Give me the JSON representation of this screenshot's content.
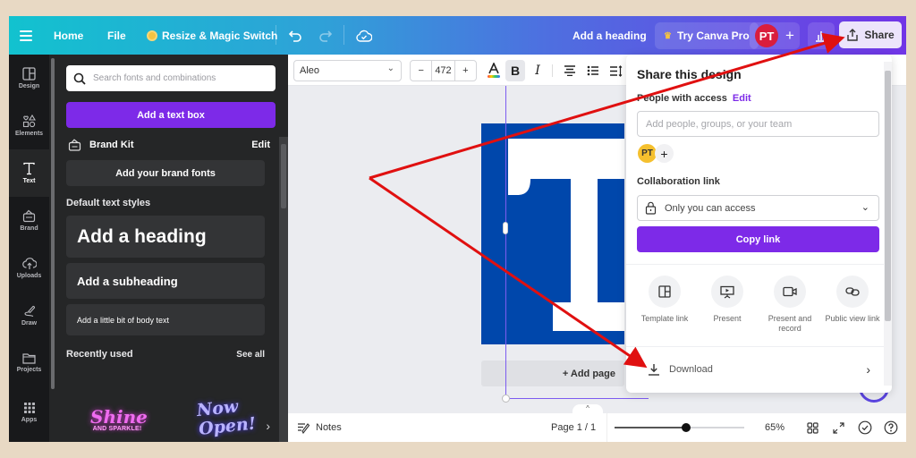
{
  "topbar": {
    "home": "Home",
    "file": "File",
    "resize": "Resize & Magic Switch",
    "doc_title": "Add a heading",
    "try_pro": "Try Canva Pro",
    "user_initials": "PT",
    "share": "Share"
  },
  "rail": [
    {
      "label": "Design",
      "icon": "layout-icon"
    },
    {
      "label": "Elements",
      "icon": "shapes-icon"
    },
    {
      "label": "Text",
      "icon": "text-icon",
      "active": true
    },
    {
      "label": "Brand",
      "icon": "brand-icon"
    },
    {
      "label": "Uploads",
      "icon": "cloud-upload-icon"
    },
    {
      "label": "Draw",
      "icon": "pen-icon"
    },
    {
      "label": "Projects",
      "icon": "folder-icon"
    },
    {
      "label": "Apps",
      "icon": "grid-icon"
    }
  ],
  "panel": {
    "search_placeholder": "Search fonts and combinations",
    "add_text_box": "Add a text box",
    "brand_kit": "Brand Kit",
    "brand_kit_edit": "Edit",
    "add_brand_fonts": "Add your brand fonts",
    "default_styles_label": "Default text styles",
    "heading": "Add a heading",
    "subheading": "Add a subheading",
    "body": "Add a little bit of body text",
    "recently_used": "Recently used",
    "see_all": "See all",
    "recent_items": [
      {
        "main": "Shine",
        "sub": "AND SPARKLE!"
      },
      {
        "main": "Now Open!"
      }
    ]
  },
  "toolbar": {
    "font": "Aleo",
    "font_size": "472",
    "decrease": "−",
    "increase": "+",
    "bold": "B",
    "italic": "I"
  },
  "canvas": {
    "add_page": "+ Add page",
    "design_color": "#0047ab"
  },
  "bottombar": {
    "notes": "Notes",
    "page": "Page 1 / 1",
    "zoom_label": "65%",
    "zoom_fraction": 0.55
  },
  "share_panel": {
    "title": "Share this design",
    "people_label": "People with access",
    "people_edit": "Edit",
    "add_people_placeholder": "Add people, groups, or your team",
    "owner_initials": "PT",
    "collab_label": "Collaboration link",
    "access": "Only you can access",
    "copy_link": "Copy link",
    "options": [
      {
        "label": "Template link",
        "icon": "template-icon"
      },
      {
        "label": "Present",
        "icon": "present-icon"
      },
      {
        "label": "Present and record",
        "icon": "camera-icon"
      },
      {
        "label": "Public view link",
        "icon": "link-icon"
      }
    ],
    "download": "Download"
  },
  "colors": {
    "accent": "#7d2ae8",
    "annotation_arrow": "#e01010"
  }
}
